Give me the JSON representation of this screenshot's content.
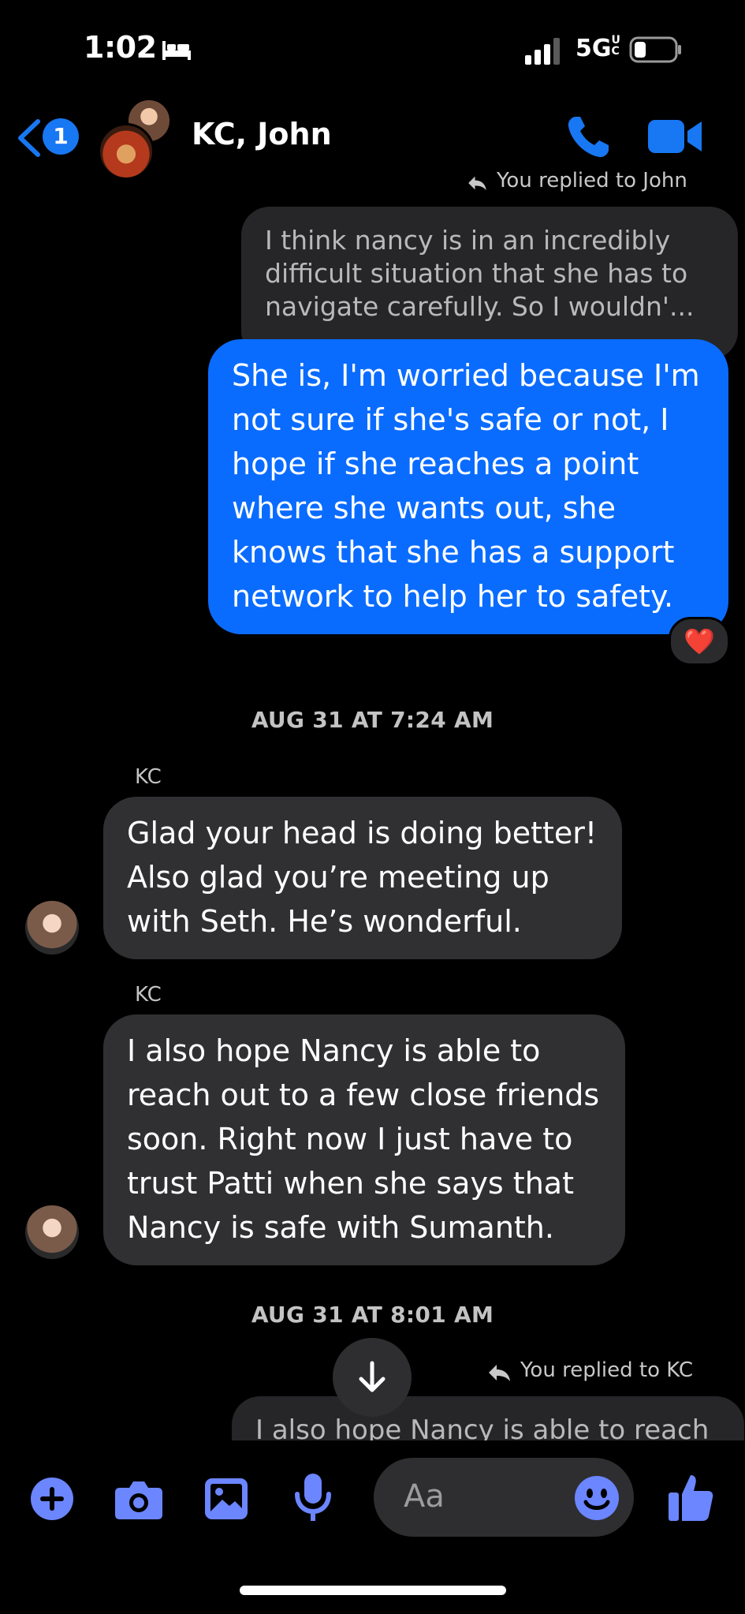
{
  "status_bar": {
    "time": "1:02",
    "network": "5G",
    "network_sub": "UC"
  },
  "header": {
    "back_badge": "1",
    "title": "KC, John"
  },
  "messages": {
    "reply1_label": "You replied to John",
    "reply1_quote": "I think nancy is in an incredibly difficult situation that she has to navigate carefully. So I wouldn'...",
    "out1": "She is, I'm worried because I'm not sure if she's safe or not, I hope if she reaches a point where she wants out, she knows that she has a support network to help her to safety.",
    "out1_reaction": "❤️",
    "timestamp1": "AUG 31 AT 7:24 AM",
    "in1_sender": "KC",
    "in1": "Glad your head is doing better! Also glad you’re meeting up with Seth. He’s wonderful.",
    "in2_sender": "KC",
    "in2": "I also hope Nancy is able to reach out to a few close friends soon. Right now I just have to trust Patti when she says that Nancy is safe with Sumanth.",
    "timestamp2": "AUG 31 AT 8:01 AM",
    "reply2_label": "You replied to KC",
    "reply2_quote": "I also hope Nancy is able to reach"
  },
  "composer": {
    "placeholder": "Aa"
  },
  "colors": {
    "accent": "#0a6cff",
    "icon_blue": "#6b86ff",
    "incoming_bg": "#303033"
  }
}
